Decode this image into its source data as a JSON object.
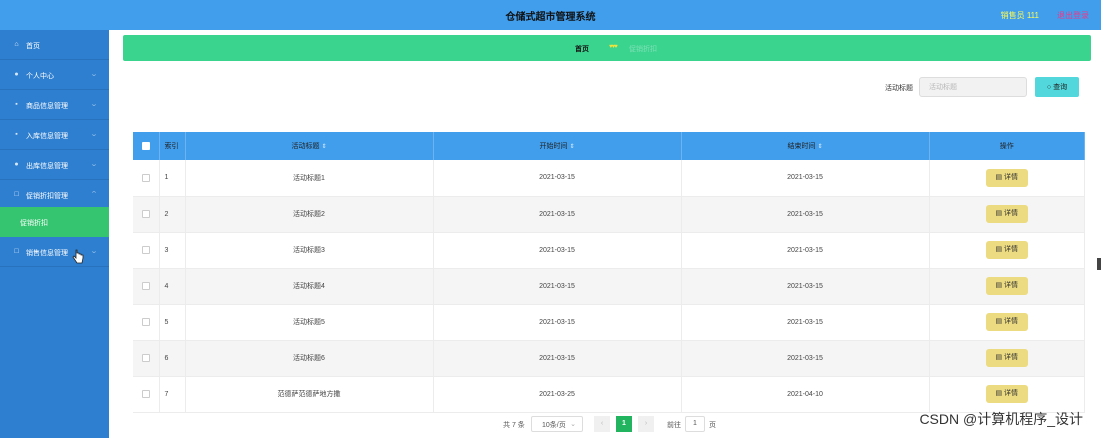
{
  "header": {
    "title": "仓储式超市管理系统",
    "user": "销售员 111",
    "logout": "退出登录"
  },
  "sidebar": {
    "items": [
      {
        "label": "首页",
        "icon": "home-icon"
      },
      {
        "label": "个人中心",
        "icon": "user-icon"
      },
      {
        "label": "商品信息管理",
        "icon": "goods-icon"
      },
      {
        "label": "入库信息管理",
        "icon": "inbound-icon"
      },
      {
        "label": "出库信息管理",
        "icon": "outbound-icon"
      },
      {
        "label": "促销折扣管理",
        "icon": "promotion-icon"
      },
      {
        "label": "销售信息管理",
        "icon": "sales-icon"
      }
    ],
    "active_sub": "促销折扣"
  },
  "breadcrumb": {
    "home": "首页",
    "separator": "♥♥♥",
    "current": "促销折扣"
  },
  "search": {
    "label": "活动标题",
    "placeholder": "活动标题",
    "button": "查询"
  },
  "table": {
    "columns": [
      "索引",
      "活动标题",
      "开始时间",
      "结束时间",
      "操作"
    ],
    "action_label": "详情",
    "rows": [
      {
        "index": "1",
        "title": "活动标题1",
        "start": "2021-03-15",
        "end": "2021-03-15"
      },
      {
        "index": "2",
        "title": "活动标题2",
        "start": "2021-03-15",
        "end": "2021-03-15"
      },
      {
        "index": "3",
        "title": "活动标题3",
        "start": "2021-03-15",
        "end": "2021-03-15"
      },
      {
        "index": "4",
        "title": "活动标题4",
        "start": "2021-03-15",
        "end": "2021-03-15"
      },
      {
        "index": "5",
        "title": "活动标题5",
        "start": "2021-03-15",
        "end": "2021-03-15"
      },
      {
        "index": "6",
        "title": "活动标题6",
        "start": "2021-03-15",
        "end": "2021-03-15"
      },
      {
        "index": "7",
        "title": "范德萨范德萨地方撒",
        "start": "2021-03-25",
        "end": "2021-04-10"
      }
    ]
  },
  "pagination": {
    "total": "共 7 条",
    "page_size": "10条/页",
    "current_page": "1",
    "goto": "前往",
    "goto_value": "1",
    "page_unit": "页"
  },
  "watermark": "CSDN @计算机程序_设计",
  "colors": {
    "topbar": "#409eed",
    "sidebar": "#2f7fd0",
    "active_sub": "#35c46f",
    "breadcrumb": "#3ad48f",
    "search_button": "#52d8dc",
    "detail_button": "#ecdb80",
    "active_page": "#22b45e"
  }
}
